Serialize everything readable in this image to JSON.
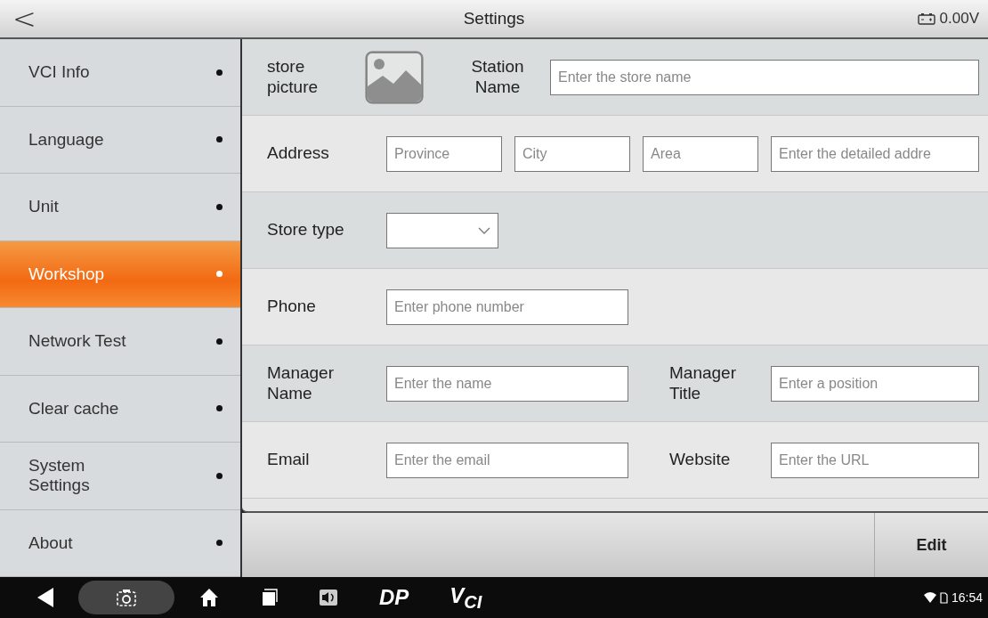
{
  "header": {
    "back": "<",
    "title": "Settings",
    "voltage": "0.00V"
  },
  "sidebar": {
    "items": [
      {
        "label": "VCI Info",
        "selected": false
      },
      {
        "label": "Language",
        "selected": false
      },
      {
        "label": "Unit",
        "selected": false
      },
      {
        "label": "Workshop",
        "selected": true
      },
      {
        "label": "Network Test",
        "selected": false
      },
      {
        "label": "Clear cache",
        "selected": false
      },
      {
        "label": "System Settings",
        "selected": false
      },
      {
        "label": "About",
        "selected": false
      }
    ]
  },
  "form": {
    "rows": [
      {
        "fields": [
          {
            "kind": "label",
            "text": "store picture"
          },
          {
            "kind": "image"
          },
          {
            "kind": "label",
            "text": "Station Name"
          },
          {
            "kind": "input",
            "placeholder": "Enter the store name"
          }
        ]
      },
      {
        "fields": [
          {
            "kind": "label",
            "text": "Address"
          },
          {
            "kind": "input",
            "placeholder": "Province"
          },
          {
            "kind": "input",
            "placeholder": "City"
          },
          {
            "kind": "input",
            "placeholder": "Area"
          },
          {
            "kind": "input",
            "placeholder": "Enter the detailed addre"
          }
        ]
      },
      {
        "fields": [
          {
            "kind": "label",
            "text": "Store type"
          },
          {
            "kind": "select"
          }
        ]
      },
      {
        "fields": [
          {
            "kind": "label",
            "text": "Phone"
          },
          {
            "kind": "input",
            "placeholder": "Enter phone number"
          }
        ]
      },
      {
        "fields": [
          {
            "kind": "label",
            "text": "Manager Name"
          },
          {
            "kind": "input",
            "placeholder": "Enter the name"
          },
          {
            "kind": "label",
            "text": "Manager Title"
          },
          {
            "kind": "input",
            "placeholder": "Enter a position"
          }
        ]
      },
      {
        "fields": [
          {
            "kind": "label",
            "text": "Email"
          },
          {
            "kind": "input",
            "placeholder": "Enter the email"
          },
          {
            "kind": "label",
            "text": "Website"
          },
          {
            "kind": "input",
            "placeholder": "Enter the URL"
          }
        ]
      }
    ]
  },
  "footer": {
    "button": "Edit"
  },
  "navbar": {
    "logos": [
      "DP",
      "V$_{CI}$"
    ],
    "time": "16:54"
  }
}
